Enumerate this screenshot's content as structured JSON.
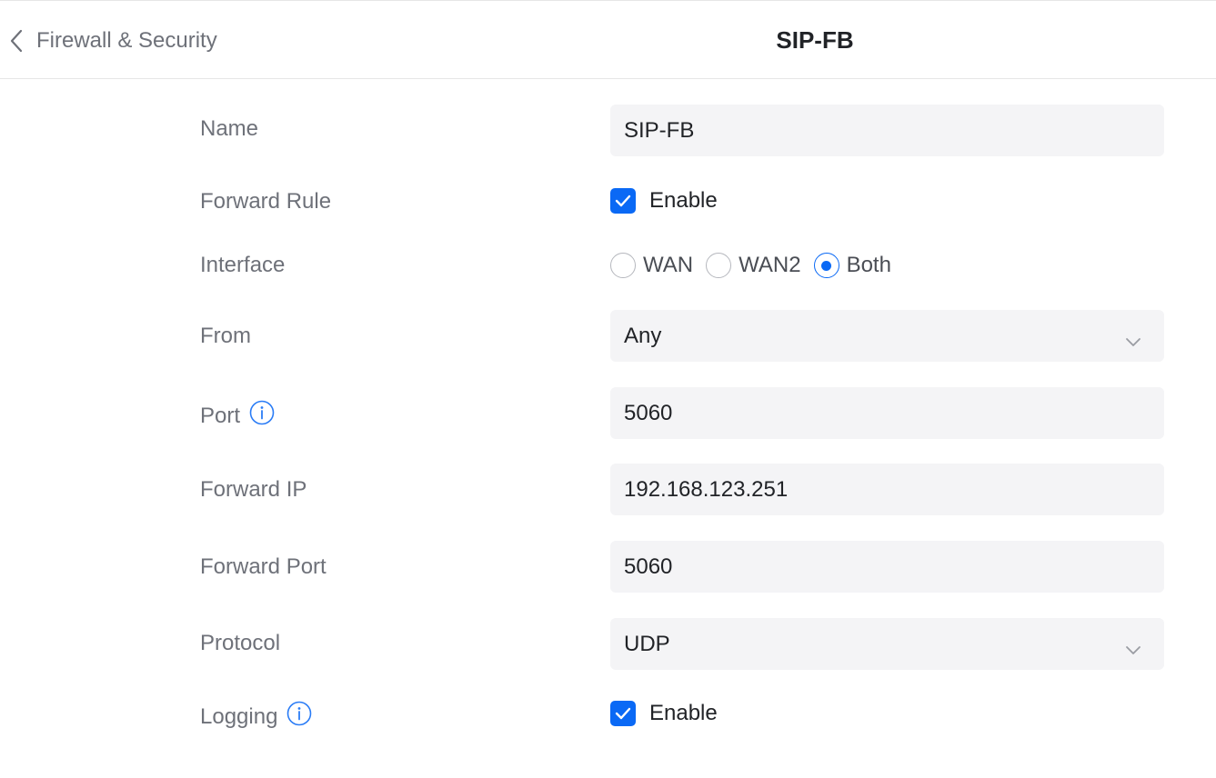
{
  "header": {
    "back_label": "Firewall & Security",
    "title": "SIP-FB"
  },
  "form": {
    "name": {
      "label": "Name",
      "value": "SIP-FB"
    },
    "forward_rule": {
      "label": "Forward Rule",
      "checked": true,
      "option_label": "Enable"
    },
    "interface": {
      "label": "Interface",
      "options": [
        "WAN",
        "WAN2",
        "Both"
      ],
      "selected": "Both"
    },
    "from": {
      "label": "From",
      "value": "Any"
    },
    "port": {
      "label": "Port",
      "value": "5060"
    },
    "forward_ip": {
      "label": "Forward IP",
      "value": "192.168.123.251"
    },
    "forward_port": {
      "label": "Forward Port",
      "value": "5060"
    },
    "protocol": {
      "label": "Protocol",
      "value": "UDP"
    },
    "logging": {
      "label": "Logging",
      "checked": true,
      "option_label": "Enable"
    }
  },
  "icons": {
    "back": "chevron-left-icon",
    "dropdown": "chevron-down-icon",
    "info": "info-circle-icon",
    "check": "checkmark-icon"
  },
  "colors": {
    "accent": "#0a69f5",
    "label_text": "#6e7179",
    "value_text": "#212327",
    "field_bg": "#f4f4f6"
  }
}
